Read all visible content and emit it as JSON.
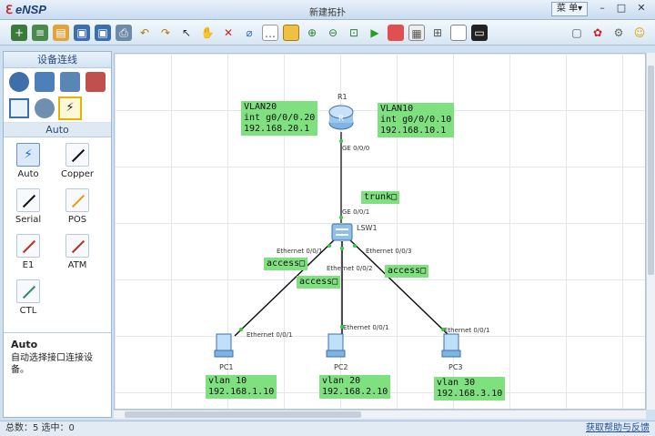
{
  "app": {
    "logo": "eNSP",
    "window_title": "新建拓扑",
    "menu_label": "菜 单▾",
    "win_controls": [
      "–",
      "□",
      "✕"
    ]
  },
  "toolbar": {
    "icons": [
      "new-topology-icon",
      "new-exam-icon",
      "open-icon",
      "save-icon",
      "save-as-icon",
      "print-icon",
      "undo-icon",
      "redo-icon",
      "select-icon",
      "pan-icon",
      "delete-icon",
      "delete-link-icon",
      "text-icon",
      "rectangle-icon",
      "zoom-in-icon",
      "zoom-out-icon",
      "fit-icon",
      "start-icon",
      "stop-icon",
      "capture-icon",
      "grid-icon",
      "topo-icon",
      "screenshot-icon"
    ],
    "right_icons": [
      "chat-icon",
      "huawei-icon",
      "settings-icon",
      "help-icon"
    ]
  },
  "left_panel": {
    "header": "设备连线",
    "device_icons": [
      "router-icon",
      "switch-icon",
      "wireless-icon",
      "firewall-icon",
      "pc-icon",
      "cloud-icon",
      "connection-icon"
    ],
    "sub_header": "Auto",
    "cables": [
      {
        "label": "Auto",
        "color": "#2a6fd6"
      },
      {
        "label": "Copper",
        "color": "#111111"
      },
      {
        "label": "Serial",
        "color": "#111111"
      },
      {
        "label": "POS",
        "color": "#f09a1e"
      },
      {
        "label": "E1",
        "color": "#b5321e"
      },
      {
        "label": "ATM",
        "color": "#b5321e"
      },
      {
        "label": "CTL",
        "color": "#2d8a6a"
      }
    ],
    "desc_title": "Auto",
    "desc_text": "自动选择接口连接设备。"
  },
  "topology": {
    "devices": {
      "r1": "R1",
      "lsw1": "LSW1",
      "pc1": "PC1",
      "pc2": "PC2",
      "pc3": "PC3"
    },
    "labels": {
      "vlan20": "VLAN20\nint g0/0/0.20\n192.168.20.1",
      "vlan10": "VLAN10\nint g0/0/0.10\n192.168.10.1",
      "trunk": "trunk□",
      "access1": "access□",
      "access2": "access□",
      "access3": "access□",
      "pc1": "vlan 10\n192.168.1.10",
      "pc2": "vlan 20\n192.168.2.10",
      "pc3": "vlan 30\n192.168.3.10"
    },
    "ports": {
      "r1_ge": "GE 0/0/0",
      "sw_ge": "GE 0/0/1",
      "sw_e1": "Ethernet 0/0/1",
      "sw_e2": "Ethernet 0/0/2",
      "sw_e3": "Ethernet 0/0/3",
      "pc1_e": "Ethernet 0/0/1",
      "pc2_e": "Ethernet 0/0/1",
      "pc3_e": "Ethernet 0/0/1"
    }
  },
  "status": {
    "left": "总数：5  选中：0",
    "right": "获取帮助与反馈"
  },
  "colors": {
    "label_bg": "#7fe07f",
    "accent": "#2a6fd6"
  }
}
